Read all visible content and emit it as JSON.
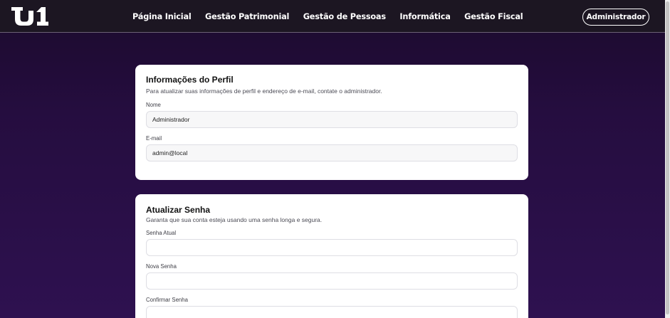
{
  "nav": {
    "logo_text": "U1",
    "links": [
      "Página Inicial",
      "Gestão Patrimonial",
      "Gestão de Pessoas",
      "Informática",
      "Gestão Fiscal"
    ],
    "user_label": "Administrador"
  },
  "profile": {
    "title": "Informações do Perfil",
    "description": "Para atualizar suas informações de perfil e endereço de e-mail, contate o administrador.",
    "name_label": "Nome",
    "name_value": "Administrador",
    "email_label": "E-mail",
    "email_value": "admin@local"
  },
  "password": {
    "title": "Atualizar Senha",
    "description": "Garanta que sua conta esteja usando uma senha longa e segura.",
    "current_label": "Senha Atual",
    "new_label": "Nova Senha",
    "confirm_label": "Confirmar Senha"
  },
  "colors": {
    "background": "#250d3f",
    "navbar": "#1c1622",
    "card": "#ffffff"
  }
}
